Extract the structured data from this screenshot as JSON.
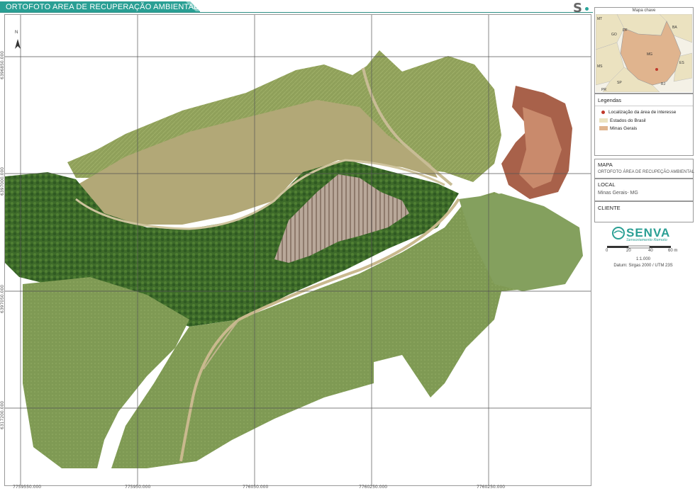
{
  "header": {
    "title": "ORTOFOTO AREA DE RECUPERAÇÃO AMBIENTAL",
    "brand_mark": "S",
    "accent_color": "#2a9f94"
  },
  "map": {
    "north_label": "N",
    "x_coordinates": [
      "7759550.000",
      "775950.000",
      "776050.000",
      "7760250.000",
      "7760250.000"
    ],
    "y_coordinates": [
      "6396850.000",
      "6397000.000",
      "6397050.000",
      "6317200.000"
    ],
    "grid": true
  },
  "key_map": {
    "title": "Mapa chave",
    "state_labels": [
      "MT",
      "GO",
      "DF",
      "BA",
      "MG",
      "ES",
      "MS",
      "SP",
      "RJ",
      "PR"
    ],
    "highlight_color": "#e0b48e",
    "states_color": "#ebe2c0",
    "marker_color": "#c0392b"
  },
  "legend": {
    "heading": "Legendas",
    "items": [
      {
        "label": "Localização da área de interesse",
        "kind": "dot",
        "color": "#c0392b"
      },
      {
        "label": "Estados do Brasil",
        "kind": "swatch",
        "color": "#ebe2c0"
      },
      {
        "label": "Minas Gerais",
        "kind": "swatch",
        "color": "#e0b48e"
      }
    ]
  },
  "info": {
    "mapa_heading": "MAPA",
    "mapa_value": "ORTOFOTO ÁREA DE RECUPEÇÃO AMBIENTAL",
    "local_heading": "LOCAL",
    "local_value": "Minas Gerais- MG",
    "cliente_heading": "CLIENTE",
    "cliente_value": ""
  },
  "logo": {
    "word": "SENVA",
    "subtitle": "Sensoriamento Remoto"
  },
  "scale": {
    "labels": [
      "0",
      "20",
      "40",
      "60 m"
    ],
    "ratio": "1:1.000",
    "datum": "Datum: Sirgas 2000 / UTM 23S"
  }
}
